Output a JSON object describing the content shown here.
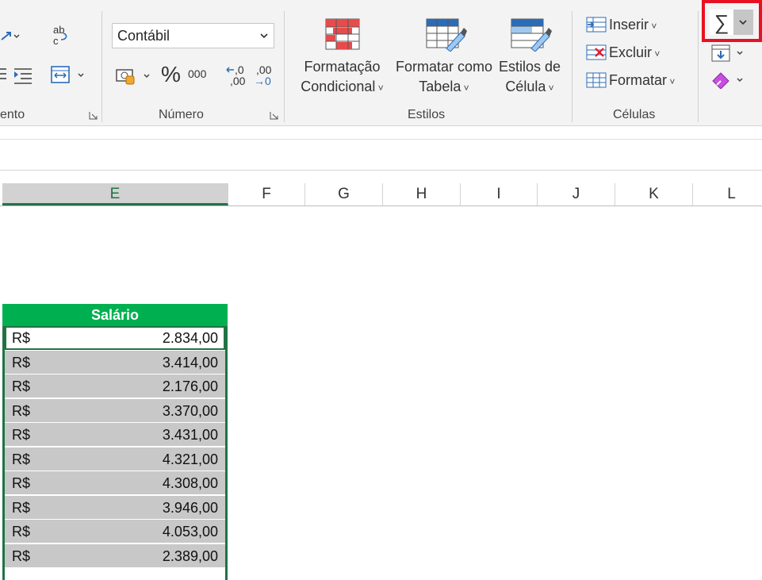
{
  "ribbon": {
    "groups": {
      "alignment_label": "ento",
      "number_label": "Número",
      "styles_label": "Estilos",
      "cells_label": "Células"
    },
    "number_format": {
      "value": "Contábil"
    },
    "percent_symbol": "%",
    "thousands_symbol": "000",
    "increase_decimal_top": ",0",
    "increase_decimal_bottom": ",00",
    "decrease_decimal_top": ",00",
    "decrease_decimal_bottom": "→0",
    "styles": {
      "conditional_line1": "Formatação",
      "conditional_line2": "Condicional",
      "table_line1": "Formatar como",
      "table_line2": "Tabela",
      "cell_line1": "Estilos de",
      "cell_line2": "Célula"
    },
    "cells": {
      "insert": "Inserir",
      "delete": "Excluir",
      "format": "Formatar"
    },
    "editing": {
      "autosum_symbol": "∑"
    }
  },
  "columns": [
    {
      "id": "E",
      "label": "E",
      "selected": true
    },
    {
      "id": "F",
      "label": "F"
    },
    {
      "id": "G",
      "label": "G"
    },
    {
      "id": "H",
      "label": "H"
    },
    {
      "id": "I",
      "label": "I"
    },
    {
      "id": "J",
      "label": "J"
    },
    {
      "id": "K",
      "label": "K"
    },
    {
      "id": "L",
      "label": "L"
    }
  ],
  "table": {
    "header": "Salário",
    "currency": "R$",
    "rows": [
      {
        "currency": "R$",
        "value": "2.834,00"
      },
      {
        "currency": "R$",
        "value": "3.414,00"
      },
      {
        "currency": "R$",
        "value": "2.176,00"
      },
      {
        "currency": "R$",
        "value": "3.370,00"
      },
      {
        "currency": "R$",
        "value": "3.431,00"
      },
      {
        "currency": "R$",
        "value": "4.321,00"
      },
      {
        "currency": "R$",
        "value": "4.308,00"
      },
      {
        "currency": "R$",
        "value": "3.946,00"
      },
      {
        "currency": "R$",
        "value": "4.053,00"
      },
      {
        "currency": "R$",
        "value": "2.389,00"
      }
    ]
  },
  "colors": {
    "accent_green": "#217346",
    "header_green": "#00b050",
    "highlight_red": "#e81123",
    "selection_gray": "#c8c8c8"
  }
}
